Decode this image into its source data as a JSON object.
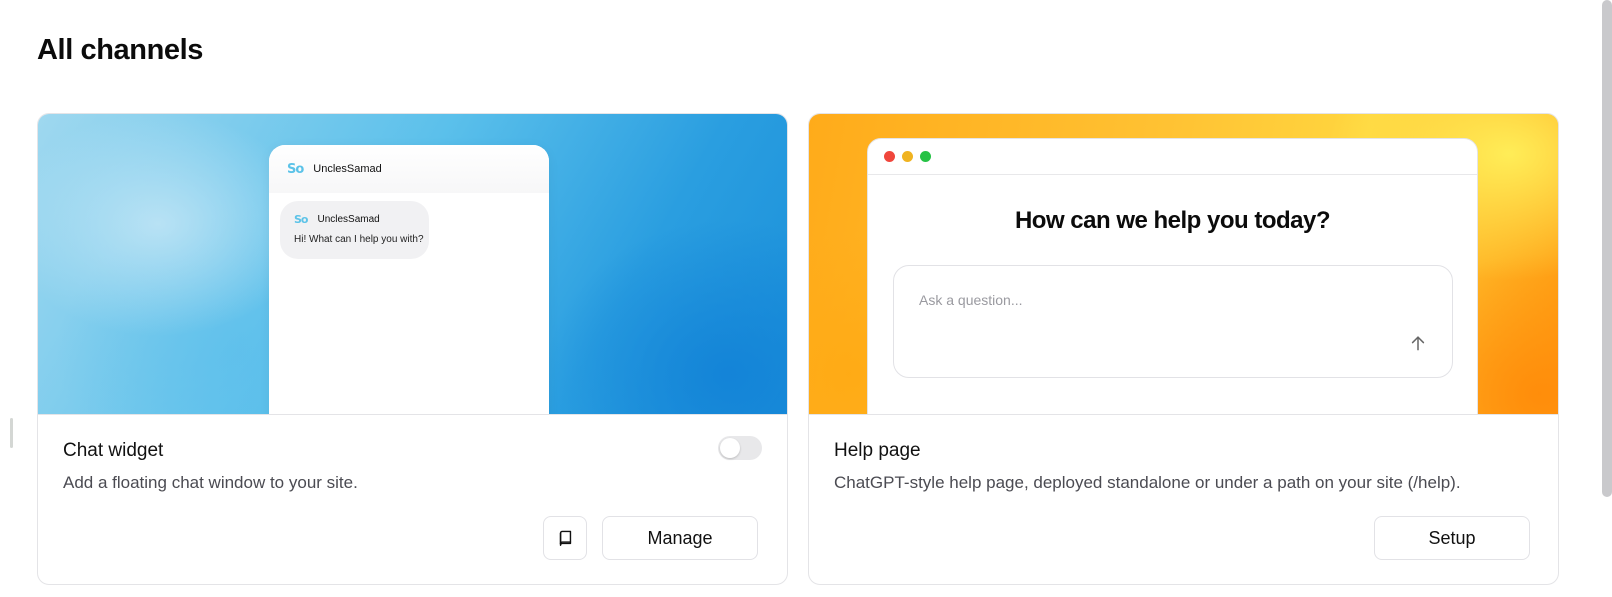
{
  "page": {
    "title": "All channels"
  },
  "channels": {
    "chat_widget": {
      "title": "Chat widget",
      "description": "Add a floating chat window to your site.",
      "enabled": false,
      "preview": {
        "logo": "So",
        "brand": "UnclesSamad",
        "bubble_brand": "UnclesSamad",
        "bubble_message": "Hi! What can I help you with?"
      },
      "docs_icon": "book-icon",
      "manage_label": "Manage"
    },
    "help_page": {
      "title": "Help page",
      "description": "ChatGPT-style help page, deployed standalone or under a path on your site (/help).",
      "preview": {
        "heading": "How can we help you today?",
        "input_placeholder": "Ask a question...",
        "send_icon": "arrow-up-icon",
        "window_dots": [
          "#f0463c",
          "#f0b320",
          "#26c245"
        ]
      },
      "setup_label": "Setup"
    }
  },
  "colors": {
    "accent_blue": "#2a9ee0",
    "accent_orange": "#ffab1a",
    "border": "#e4e4e7"
  }
}
